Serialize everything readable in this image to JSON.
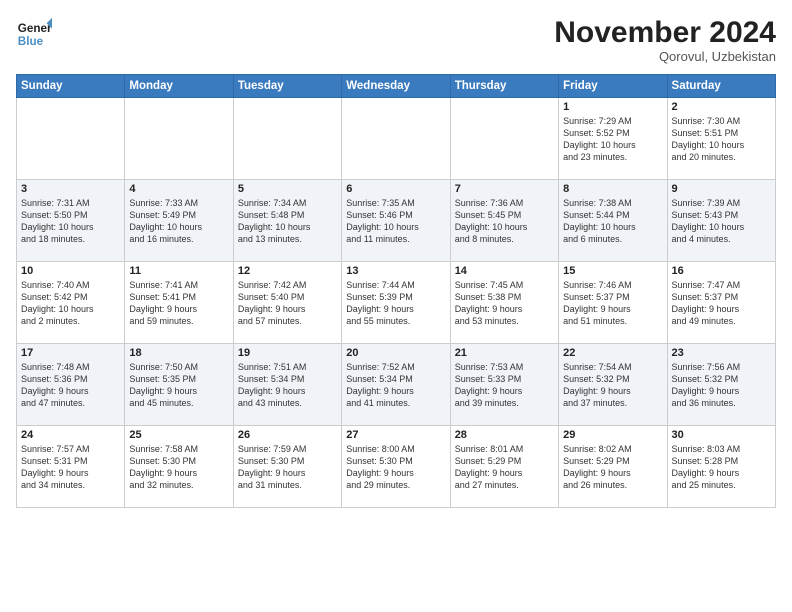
{
  "header": {
    "logo_line1": "General",
    "logo_line2": "Blue",
    "month": "November 2024",
    "location": "Qorovul, Uzbekistan"
  },
  "weekdays": [
    "Sunday",
    "Monday",
    "Tuesday",
    "Wednesday",
    "Thursday",
    "Friday",
    "Saturday"
  ],
  "weeks": [
    {
      "alt": false,
      "days": [
        {
          "num": "",
          "info": ""
        },
        {
          "num": "",
          "info": ""
        },
        {
          "num": "",
          "info": ""
        },
        {
          "num": "",
          "info": ""
        },
        {
          "num": "",
          "info": ""
        },
        {
          "num": "1",
          "info": "Sunrise: 7:29 AM\nSunset: 5:52 PM\nDaylight: 10 hours\nand 23 minutes."
        },
        {
          "num": "2",
          "info": "Sunrise: 7:30 AM\nSunset: 5:51 PM\nDaylight: 10 hours\nand 20 minutes."
        }
      ]
    },
    {
      "alt": true,
      "days": [
        {
          "num": "3",
          "info": "Sunrise: 7:31 AM\nSunset: 5:50 PM\nDaylight: 10 hours\nand 18 minutes."
        },
        {
          "num": "4",
          "info": "Sunrise: 7:33 AM\nSunset: 5:49 PM\nDaylight: 10 hours\nand 16 minutes."
        },
        {
          "num": "5",
          "info": "Sunrise: 7:34 AM\nSunset: 5:48 PM\nDaylight: 10 hours\nand 13 minutes."
        },
        {
          "num": "6",
          "info": "Sunrise: 7:35 AM\nSunset: 5:46 PM\nDaylight: 10 hours\nand 11 minutes."
        },
        {
          "num": "7",
          "info": "Sunrise: 7:36 AM\nSunset: 5:45 PM\nDaylight: 10 hours\nand 8 minutes."
        },
        {
          "num": "8",
          "info": "Sunrise: 7:38 AM\nSunset: 5:44 PM\nDaylight: 10 hours\nand 6 minutes."
        },
        {
          "num": "9",
          "info": "Sunrise: 7:39 AM\nSunset: 5:43 PM\nDaylight: 10 hours\nand 4 minutes."
        }
      ]
    },
    {
      "alt": false,
      "days": [
        {
          "num": "10",
          "info": "Sunrise: 7:40 AM\nSunset: 5:42 PM\nDaylight: 10 hours\nand 2 minutes."
        },
        {
          "num": "11",
          "info": "Sunrise: 7:41 AM\nSunset: 5:41 PM\nDaylight: 9 hours\nand 59 minutes."
        },
        {
          "num": "12",
          "info": "Sunrise: 7:42 AM\nSunset: 5:40 PM\nDaylight: 9 hours\nand 57 minutes."
        },
        {
          "num": "13",
          "info": "Sunrise: 7:44 AM\nSunset: 5:39 PM\nDaylight: 9 hours\nand 55 minutes."
        },
        {
          "num": "14",
          "info": "Sunrise: 7:45 AM\nSunset: 5:38 PM\nDaylight: 9 hours\nand 53 minutes."
        },
        {
          "num": "15",
          "info": "Sunrise: 7:46 AM\nSunset: 5:37 PM\nDaylight: 9 hours\nand 51 minutes."
        },
        {
          "num": "16",
          "info": "Sunrise: 7:47 AM\nSunset: 5:37 PM\nDaylight: 9 hours\nand 49 minutes."
        }
      ]
    },
    {
      "alt": true,
      "days": [
        {
          "num": "17",
          "info": "Sunrise: 7:48 AM\nSunset: 5:36 PM\nDaylight: 9 hours\nand 47 minutes."
        },
        {
          "num": "18",
          "info": "Sunrise: 7:50 AM\nSunset: 5:35 PM\nDaylight: 9 hours\nand 45 minutes."
        },
        {
          "num": "19",
          "info": "Sunrise: 7:51 AM\nSunset: 5:34 PM\nDaylight: 9 hours\nand 43 minutes."
        },
        {
          "num": "20",
          "info": "Sunrise: 7:52 AM\nSunset: 5:34 PM\nDaylight: 9 hours\nand 41 minutes."
        },
        {
          "num": "21",
          "info": "Sunrise: 7:53 AM\nSunset: 5:33 PM\nDaylight: 9 hours\nand 39 minutes."
        },
        {
          "num": "22",
          "info": "Sunrise: 7:54 AM\nSunset: 5:32 PM\nDaylight: 9 hours\nand 37 minutes."
        },
        {
          "num": "23",
          "info": "Sunrise: 7:56 AM\nSunset: 5:32 PM\nDaylight: 9 hours\nand 36 minutes."
        }
      ]
    },
    {
      "alt": false,
      "days": [
        {
          "num": "24",
          "info": "Sunrise: 7:57 AM\nSunset: 5:31 PM\nDaylight: 9 hours\nand 34 minutes."
        },
        {
          "num": "25",
          "info": "Sunrise: 7:58 AM\nSunset: 5:30 PM\nDaylight: 9 hours\nand 32 minutes."
        },
        {
          "num": "26",
          "info": "Sunrise: 7:59 AM\nSunset: 5:30 PM\nDaylight: 9 hours\nand 31 minutes."
        },
        {
          "num": "27",
          "info": "Sunrise: 8:00 AM\nSunset: 5:30 PM\nDaylight: 9 hours\nand 29 minutes."
        },
        {
          "num": "28",
          "info": "Sunrise: 8:01 AM\nSunset: 5:29 PM\nDaylight: 9 hours\nand 27 minutes."
        },
        {
          "num": "29",
          "info": "Sunrise: 8:02 AM\nSunset: 5:29 PM\nDaylight: 9 hours\nand 26 minutes."
        },
        {
          "num": "30",
          "info": "Sunrise: 8:03 AM\nSunset: 5:28 PM\nDaylight: 9 hours\nand 25 minutes."
        }
      ]
    }
  ]
}
